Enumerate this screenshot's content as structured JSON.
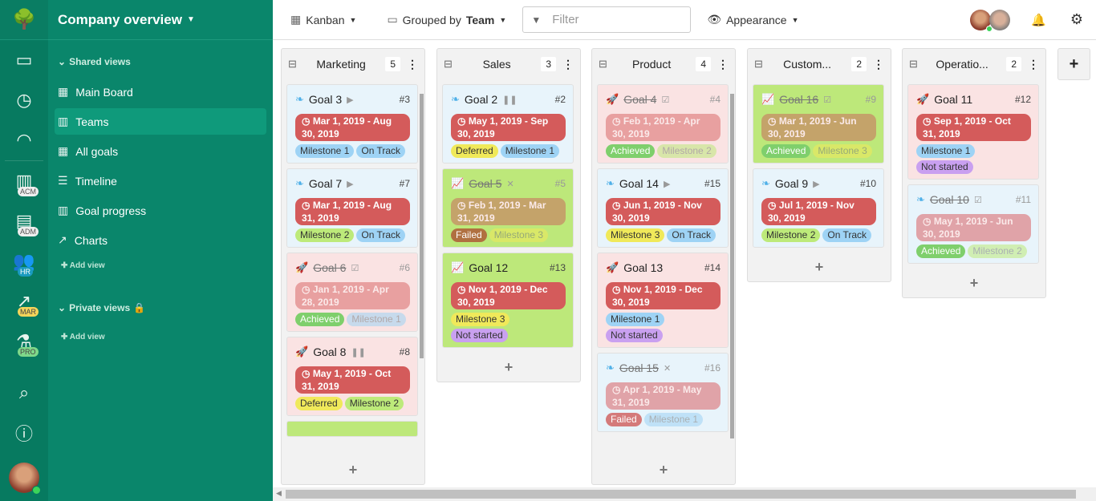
{
  "rail": {
    "badges": [
      "ACM",
      "ADM",
      "HR",
      "MAR",
      "PRO"
    ]
  },
  "sidebar": {
    "title": "Company overview",
    "shared_label": "Shared views",
    "private_label": "Private views",
    "add_view": "Add view",
    "items": [
      {
        "label": "Main Board",
        "icon": "grid-icon"
      },
      {
        "label": "Teams",
        "icon": "kanban-icon",
        "active": true
      },
      {
        "label": "All goals",
        "icon": "grid-icon"
      },
      {
        "label": "Timeline",
        "icon": "timeline-icon"
      },
      {
        "label": "Goal progress",
        "icon": "kanban-icon"
      },
      {
        "label": "Charts",
        "icon": "chart-icon"
      }
    ]
  },
  "toolbar": {
    "view": "Kanban",
    "grouped_prefix": "Grouped by",
    "grouped_value": "Team",
    "filter_placeholder": "Filter",
    "appearance": "Appearance"
  },
  "columns": [
    {
      "name": "Marketing",
      "count": "5",
      "cards": [
        {
          "title": "Goal 3",
          "icon": "leaf",
          "status": "play",
          "num": "#3",
          "bg": "blue",
          "date": "Mar 1, 2019 - Aug 30, 2019",
          "tags": [
            "Milestone 1",
            "On Track"
          ]
        },
        {
          "title": "Goal 7",
          "icon": "leaf",
          "status": "play",
          "num": "#7",
          "bg": "blue",
          "date": "Mar 1, 2019 - Aug 31, 2019",
          "tags": [
            "Milestone 2",
            "On Track"
          ]
        },
        {
          "title": "Goal 6",
          "icon": "rocket",
          "status": "check",
          "num": "#6",
          "bg": "pink",
          "done": true,
          "date": "Jan 1, 2019 - Apr 28, 2019",
          "tags": [
            "Achieved",
            "Milestone 1"
          ]
        },
        {
          "title": "Goal 8",
          "icon": "rocket",
          "status": "pause",
          "num": "#8",
          "bg": "pink",
          "date": "May 1, 2019 - Oct 31, 2019",
          "tags": [
            "Deferred",
            "Milestone 2"
          ]
        },
        {
          "title": "",
          "icon": "",
          "status": "",
          "num": "",
          "bg": "green",
          "date": "",
          "tags": []
        }
      ]
    },
    {
      "name": "Sales",
      "count": "3",
      "cards": [
        {
          "title": "Goal 2",
          "icon": "leaf",
          "status": "pause",
          "num": "#2",
          "bg": "blue",
          "date": "May 1, 2019 - Sep 30, 2019",
          "tags": [
            "Deferred",
            "Milestone 1"
          ]
        },
        {
          "title": "Goal 5",
          "icon": "chart",
          "status": "x",
          "num": "#5",
          "bg": "green",
          "done": true,
          "date": "Feb 1, 2019 - Mar 31, 2019",
          "tags": [
            "Failed",
            "Milestone 3"
          ]
        },
        {
          "title": "Goal 12",
          "icon": "chart",
          "status": "",
          "num": "#13",
          "bg": "green",
          "date": "Nov 1, 2019 - Dec 30, 2019",
          "tags": [
            "Milestone 3",
            "Not started"
          ]
        }
      ]
    },
    {
      "name": "Product",
      "count": "4",
      "cards": [
        {
          "title": "Goal 4",
          "icon": "rocket",
          "status": "check",
          "num": "#4",
          "bg": "pink",
          "done": true,
          "date": "Feb 1, 2019 - Apr 30, 2019",
          "tags": [
            "Achieved",
            "Milestone 2"
          ]
        },
        {
          "title": "Goal 14",
          "icon": "leaf",
          "status": "play",
          "num": "#15",
          "bg": "blue",
          "date": "Jun 1, 2019 - Nov 30, 2019",
          "tags": [
            "Milestone 3",
            "On Track"
          ]
        },
        {
          "title": "Goal 13",
          "icon": "rocket",
          "status": "",
          "num": "#14",
          "bg": "pink",
          "date": "Nov 1, 2019 - Dec 30, 2019",
          "tags": [
            "Milestone 1",
            "Not started"
          ]
        },
        {
          "title": "Goal 15",
          "icon": "leaf",
          "status": "x",
          "num": "#16",
          "bg": "blue",
          "done": true,
          "date": "Apr 1, 2019 - May 31, 2019",
          "tags": [
            "Failed",
            "Milestone 1"
          ]
        }
      ]
    },
    {
      "name": "Custom...",
      "count": "2",
      "cards": [
        {
          "title": "Goal 16",
          "icon": "chart",
          "status": "check",
          "num": "#9",
          "bg": "green",
          "done": true,
          "date": "Mar 1, 2019 - Jun 30, 2019",
          "tags": [
            "Achieved",
            "Milestone 3"
          ]
        },
        {
          "title": "Goal 9",
          "icon": "leaf",
          "status": "play",
          "num": "#10",
          "bg": "blue",
          "date": "Jul 1, 2019 - Nov 30, 2019",
          "tags": [
            "Milestone 2",
            "On Track"
          ]
        }
      ]
    },
    {
      "name": "Operatio...",
      "count": "2",
      "cards": [
        {
          "title": "Goal 11",
          "icon": "rocket",
          "status": "",
          "num": "#12",
          "bg": "pink",
          "date": "Sep 1, 2019 - Oct 31, 2019",
          "tags": [
            "Milestone 1",
            "Not started"
          ]
        },
        {
          "title": "Goal 10",
          "icon": "leaf",
          "status": "check",
          "num": "#11",
          "bg": "blue",
          "done": true,
          "date": "May 1, 2019 - Jun 30, 2019",
          "tags": [
            "Achieved",
            "Milestone 2"
          ]
        }
      ]
    }
  ],
  "colors": {
    "date": "#d45b5b",
    "Milestone 1": "#9ed3f5",
    "On Track": "#9ed3f5",
    "Milestone 2": "#bdea7a",
    "Milestone 3": "#f0e95a",
    "Deferred": "#f0e95a",
    "Not started": "#c9a0f0",
    "Achieved": "#7fcf6c",
    "Failed": "#c98a6a"
  }
}
